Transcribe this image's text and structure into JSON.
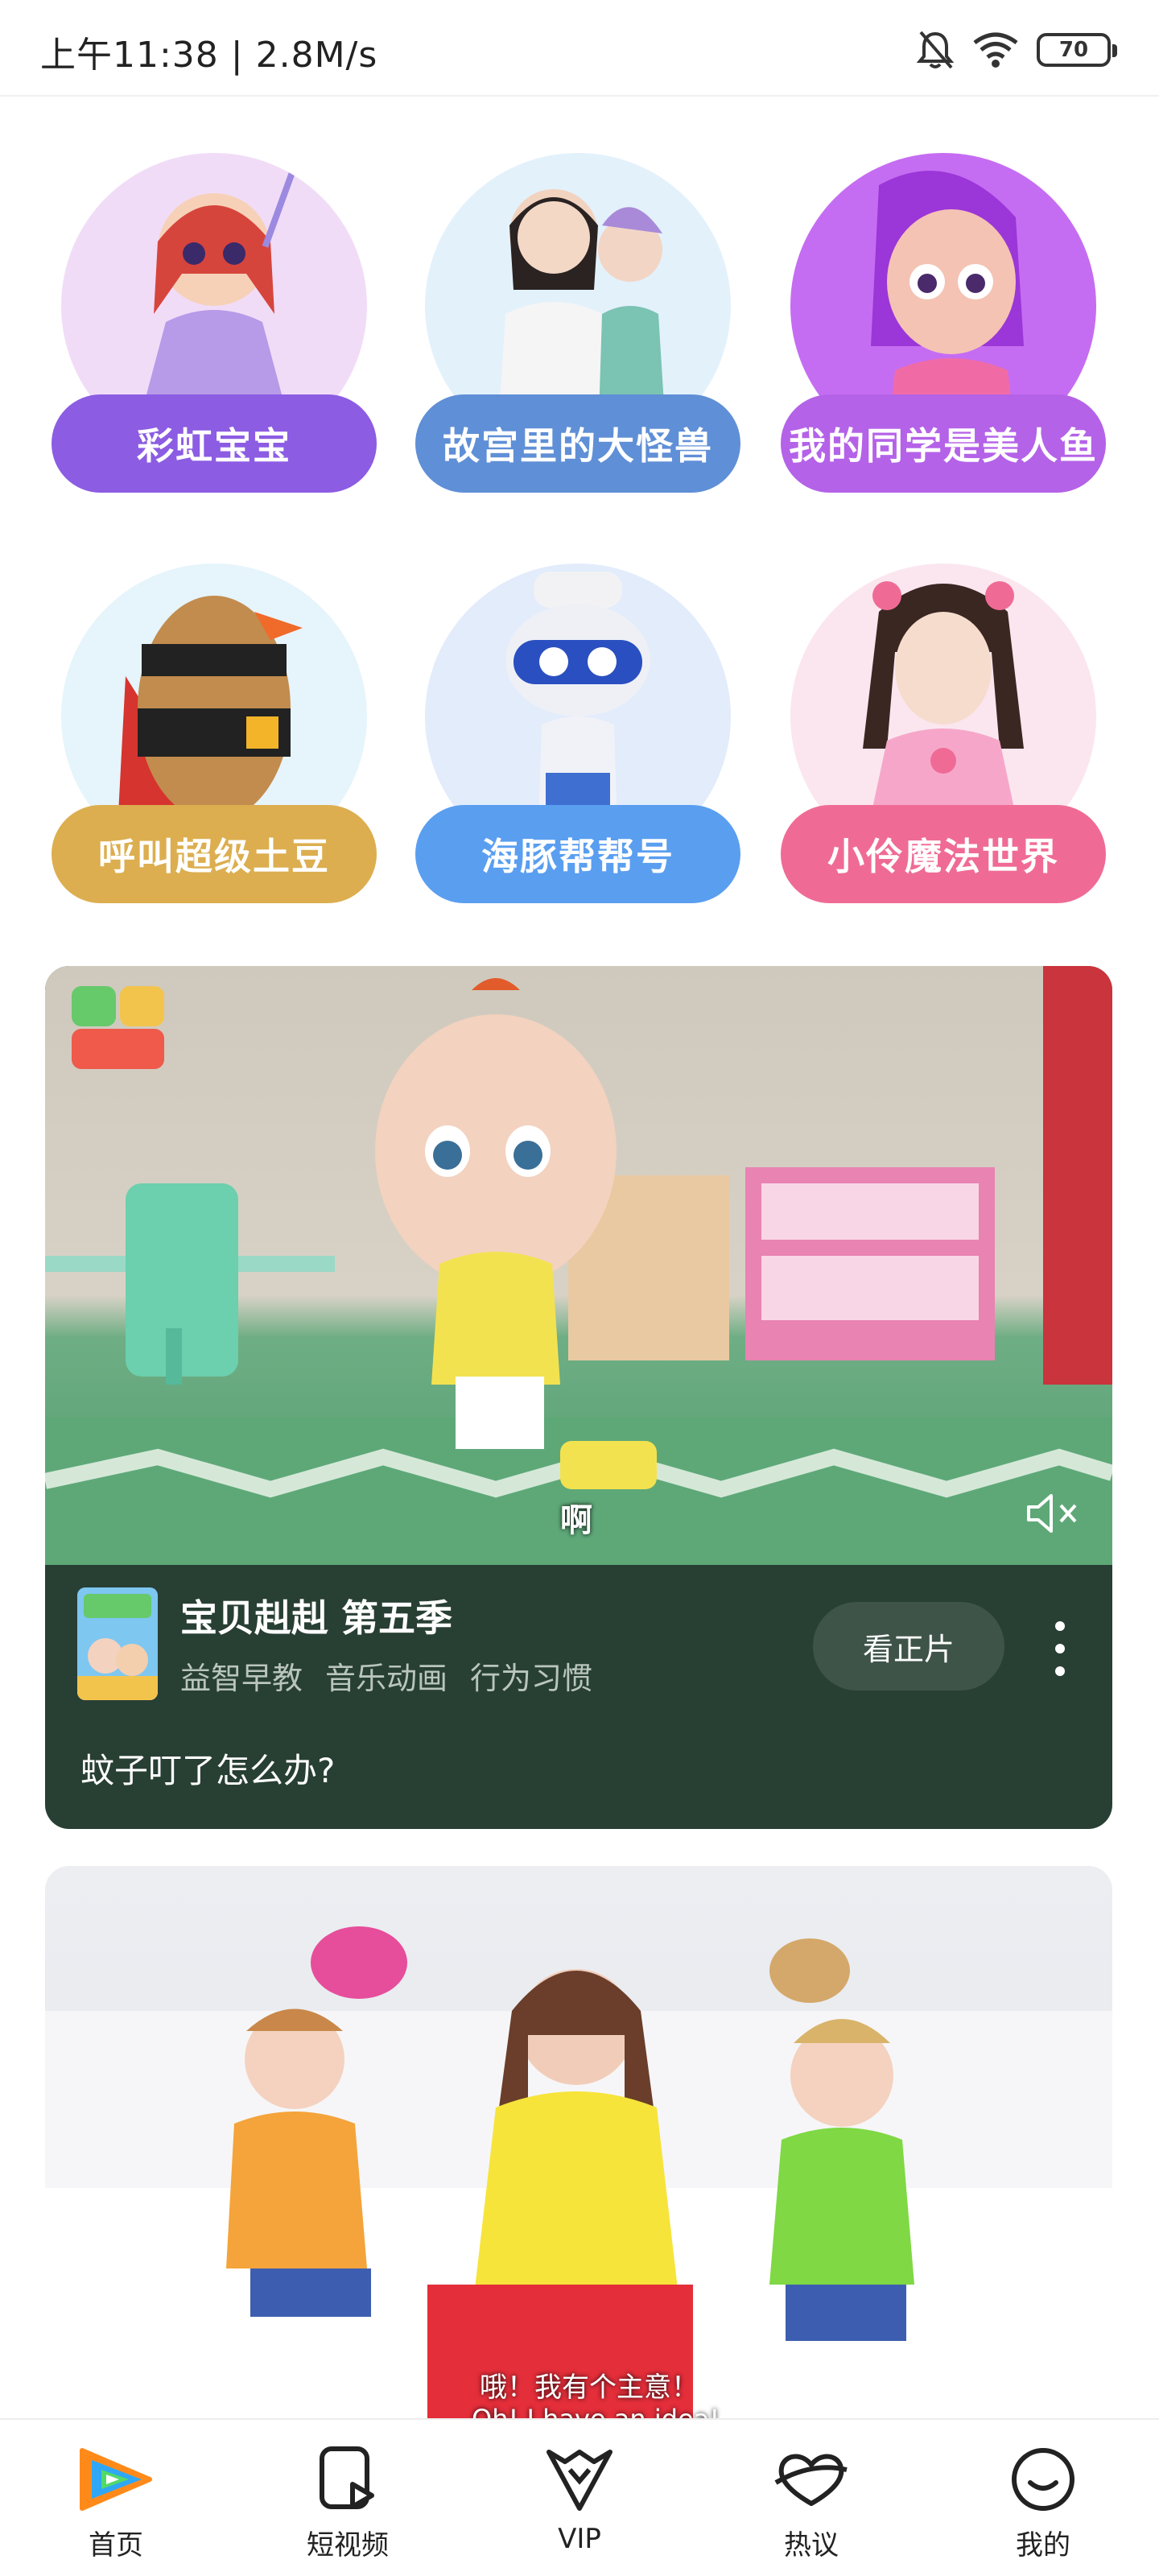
{
  "status_bar": {
    "time": "上午11:38 | 2.8M/s",
    "battery": "70",
    "icons": [
      "bell-muted-icon",
      "wifi-icon",
      "battery-icon"
    ]
  },
  "characters": [
    {
      "label": "彩虹宝宝",
      "pill_color": "#8c5ce3",
      "bg_color": "#f1dcf7",
      "figure_color": "#c9a7f0"
    },
    {
      "label": "故宫里的大怪兽",
      "pill_color": "#5f8fd6",
      "bg_color": "#e3f1fb",
      "figure_color": "#f2f2f2"
    },
    {
      "label": "我的同学是美人鱼",
      "pill_color": "#b462e8",
      "bg_color": "#c56df2",
      "figure_color": "#f1b8e3"
    },
    {
      "label": "呼叫超级土豆",
      "pill_color": "#dcae4f",
      "bg_color": "#e6f4fb",
      "figure_color": "#c28c4e"
    },
    {
      "label": "海豚帮帮号",
      "pill_color": "#5a9ef0",
      "bg_color": "#e2ecfb",
      "figure_color": "#3f6fd0"
    },
    {
      "label": "小伶魔法世界",
      "pill_color": "#ef6b95",
      "bg_color": "#fbe6ef",
      "figure_color": "#f6a7c9"
    }
  ],
  "video1": {
    "brand_logo_text": "宝贝赳赳",
    "caption": "啊",
    "show_title": "宝贝赳赳 第五季",
    "tags": [
      "益智早教",
      "音乐动画",
      "行为习惯"
    ],
    "watch_button": "看正片",
    "episode_title": "蚊子叮了怎么办?",
    "mute_icon": "volume-muted-icon",
    "more_icon": "more-vertical-icon",
    "info_bg": "#283f34"
  },
  "video2": {
    "subtitle_cn": "哦！我有个主意！",
    "subtitle_en": "Oh! I have an idea!"
  },
  "bottom_nav": [
    {
      "label": "首页",
      "icon": "tencent-video-logo-icon",
      "active": true
    },
    {
      "label": "短视频",
      "icon": "short-video-icon",
      "active": false
    },
    {
      "label": "VIP",
      "icon": "vip-crown-icon",
      "active": false
    },
    {
      "label": "热议",
      "icon": "discussion-icon",
      "active": false
    },
    {
      "label": "我的",
      "icon": "profile-smile-icon",
      "active": false
    }
  ]
}
